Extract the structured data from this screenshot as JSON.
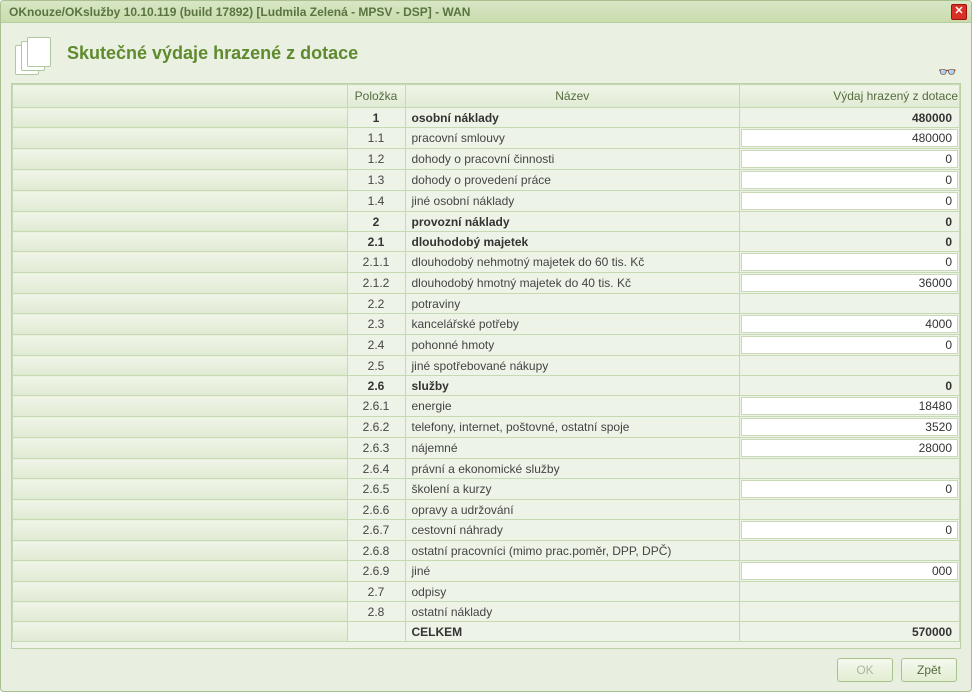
{
  "window": {
    "title": "OKnouze/OKslužby 10.10.119 (build 17892)  [Ludmila Zelená - MPSV - DSP] - WAN"
  },
  "page": {
    "title": "Skutečné výdaje hrazené z dotace"
  },
  "columns": {
    "num": "Položka",
    "name": "Název",
    "val": "Výdaj hrazený z dotace"
  },
  "rows": [
    {
      "num": "1",
      "name": "osobní náklady",
      "val": "480000",
      "bold": true,
      "editable": false
    },
    {
      "num": "1.1",
      "name": "pracovní smlouvy",
      "val": "480000",
      "editable": true
    },
    {
      "num": "1.2",
      "name": "dohody o pracovní činnosti",
      "val": "0",
      "editable": true
    },
    {
      "num": "1.3",
      "name": "dohody o provedení práce",
      "val": "0",
      "editable": true
    },
    {
      "num": "1.4",
      "name": "jiné osobní náklady",
      "val": "0",
      "editable": true
    },
    {
      "num": "2",
      "name": "provozní náklady",
      "val": "0",
      "bold": true,
      "editable": false
    },
    {
      "num": "2.1",
      "name": "dlouhodobý majetek",
      "val": "0",
      "bold": true,
      "editable": false
    },
    {
      "num": "2.1.1",
      "name": "dlouhodobý nehmotný majetek do 60 tis. Kč",
      "val": "0",
      "editable": true
    },
    {
      "num": "2.1.2",
      "name": "dlouhodobý hmotný majetek do 40 tis. Kč",
      "val": "36000",
      "editable": true
    },
    {
      "num": "2.2",
      "name": "potraviny",
      "val": "",
      "editable": false
    },
    {
      "num": "2.3",
      "name": "kancelářské potřeby",
      "val": "4000",
      "editable": true
    },
    {
      "num": "2.4",
      "name": "pohonné hmoty",
      "val": "0",
      "editable": true
    },
    {
      "num": "2.5",
      "name": "jiné spotřebované nákupy",
      "val": "",
      "editable": false
    },
    {
      "num": "2.6",
      "name": "služby",
      "val": "0",
      "bold": true,
      "editable": false
    },
    {
      "num": "2.6.1",
      "name": "energie",
      "val": "18480",
      "editable": true
    },
    {
      "num": "2.6.2",
      "name": "telefony, internet, poštovné, ostatní spoje",
      "val": "3520",
      "editable": true
    },
    {
      "num": "2.6.3",
      "name": "nájemné",
      "val": "28000",
      "editable": true
    },
    {
      "num": "2.6.4",
      "name": "právní a ekonomické služby",
      "val": "",
      "editable": false
    },
    {
      "num": "2.6.5",
      "name": "školení a kurzy",
      "val": "0",
      "editable": true
    },
    {
      "num": "2.6.6",
      "name": "opravy a udržování",
      "val": "",
      "editable": false
    },
    {
      "num": "2.6.7",
      "name": "cestovní náhrady",
      "val": "0",
      "editable": true
    },
    {
      "num": "2.6.8",
      "name": "ostatní pracovníci (mimo prac.poměr, DPP, DPČ)",
      "val": "",
      "editable": false
    },
    {
      "num": "2.6.9",
      "name": "jiné",
      "val": "000",
      "editable": true
    },
    {
      "num": "2.7",
      "name": "odpisy",
      "val": "",
      "editable": false
    },
    {
      "num": "2.8",
      "name": "ostatní náklady",
      "val": "",
      "editable": false
    },
    {
      "num": "",
      "name": "CELKEM",
      "val": "570000",
      "bold": true,
      "editable": false,
      "total": true
    }
  ],
  "buttons": {
    "ok": "OK",
    "back": "Zpět"
  }
}
